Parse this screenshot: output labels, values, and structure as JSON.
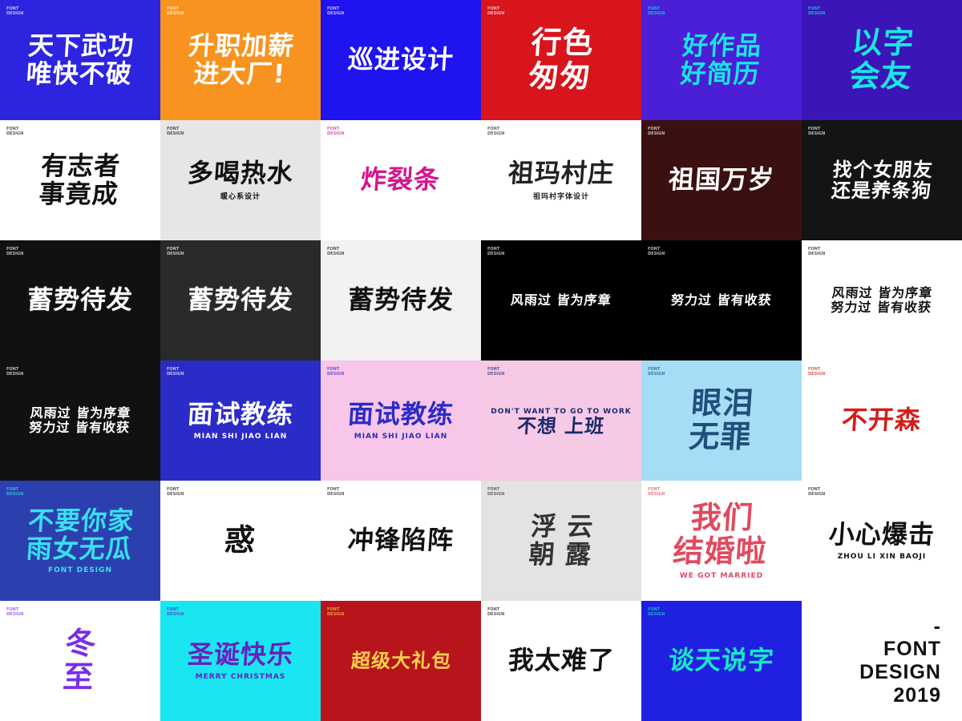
{
  "label": "FONT DESIGN",
  "tiles": [
    {
      "text": "天下武功\n唯快不破",
      "bg": "#2d24e0",
      "fg": "#ffffff"
    },
    {
      "text": "升职加薪\n进大厂!",
      "bg": "#f7931e",
      "fg": "#ffffff"
    },
    {
      "text": "巡进设计",
      "bg": "#1f13f0",
      "fg": "#ffffff"
    },
    {
      "text": "行色\n匆匆",
      "bg": "#d8141c",
      "fg": "#ffffff"
    },
    {
      "text": "好作品\n好简历",
      "bg": "#4a1fd6",
      "fg": "#19e6e6"
    },
    {
      "text": "以字\n会友",
      "bg": "#3b15b8",
      "fg": "#19e6e6"
    },
    {
      "text": "有志者\n事竟成",
      "bg": "#ffffff",
      "fg": "#111111"
    },
    {
      "text": "多喝热水",
      "bg": "#e6e6e6",
      "fg": "#111111",
      "sub": "暖心系设计"
    },
    {
      "text": "炸裂条",
      "bg": "#ffffff",
      "fg": "#d4148f"
    },
    {
      "text": "祖玛村庄",
      "bg": "#ffffff",
      "fg": "#222222",
      "sub": "祖玛村字体设计"
    },
    {
      "text": "祖国万岁",
      "bg": "#3a1010",
      "fg": "#ffffff"
    },
    {
      "text": "找个女朋友\n还是养条狗",
      "bg": "#141414",
      "fg": "#ffffff"
    },
    {
      "text": "蓄势待发",
      "bg": "#111111",
      "fg": "#ffffff"
    },
    {
      "text": "蓄势待发",
      "bg": "#2a2a2a",
      "fg": "#ffffff"
    },
    {
      "text": "蓄势待发",
      "bg": "#f2f2f2",
      "fg": "#111111"
    },
    {
      "text": "风雨过 皆为序章",
      "bg": "#000000",
      "fg": "#ffffff"
    },
    {
      "text": "努力过 皆有收获",
      "bg": "#000000",
      "fg": "#ffffff"
    },
    {
      "text": "风雨过 皆为序章\n努力过 皆有收获",
      "bg": "#ffffff",
      "fg": "#111111"
    },
    {
      "text": "风雨过 皆为序章\n努力过 皆有收获",
      "bg": "#111111",
      "fg": "#ffffff"
    },
    {
      "text": "面试教练",
      "bg": "#2b2bc8",
      "fg": "#ffffff",
      "sub": "MIAN  SHI  JIAO  LIAN"
    },
    {
      "text": "面试教练",
      "bg": "#f7c6e8",
      "fg": "#2b2bc8",
      "sub": "MIAN  SHI  JIAO  LIAN"
    },
    {
      "text": "不想 上班",
      "bg": "#f6c9e6",
      "fg": "#1b2a6b",
      "pre": "DON'T WANT TO   GO TO WORK"
    },
    {
      "text": "眼泪\n无罪",
      "bg": "#a6dcf5",
      "fg": "#1f4f7a"
    },
    {
      "text": "不开森",
      "bg": "#ffffff",
      "fg": "#d41c1c"
    },
    {
      "text": "不要你家\n雨女无瓜",
      "bg": "#2c3fae",
      "fg": "#38e0f0",
      "sub": "FONT DESIGN"
    },
    {
      "text": "惑",
      "bg": "#ffffff",
      "fg": "#111111"
    },
    {
      "text": "冲锋陷阵",
      "bg": "#ffffff",
      "fg": "#111111"
    },
    {
      "text": "浮 云\n朝 露",
      "bg": "#e3e3e3",
      "fg": "#333333"
    },
    {
      "text": "我们\n结婚啦",
      "bg": "#ffffff",
      "fg": "#e04a5f",
      "sub": "WE GOT MARRIED"
    },
    {
      "text": "小心爆击",
      "bg": "#ffffff",
      "fg": "#111111",
      "sub": "ZHOU LI XIN  BAOJI"
    },
    {
      "text": "冬\n至",
      "bg": "#ffffff",
      "fg": "#7a2ee6"
    },
    {
      "text": "圣诞快乐",
      "bg": "#19e6f0",
      "fg": "#6a1fc0",
      "sub": "MERRY CHRISTMAS"
    },
    {
      "text": "超级大礼包",
      "bg": "#b8141c",
      "fg": "#ffd24a"
    },
    {
      "text": "我太难了",
      "bg": "#ffffff",
      "fg": "#111111"
    },
    {
      "text": "谈天说字",
      "bg": "#2020e0",
      "fg": "#19e6c8"
    }
  ],
  "final": {
    "text": "-\nFONT\nDESIGN\n2019",
    "bg": "#ffffff",
    "fg": "#111111"
  }
}
